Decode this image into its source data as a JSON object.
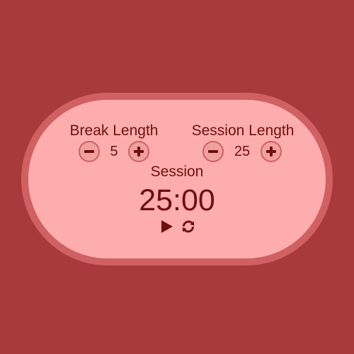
{
  "break": {
    "label": "Break Length",
    "value": "5",
    "decrement_icon": "minus-circle-icon",
    "increment_icon": "plus-circle-icon"
  },
  "session": {
    "label": "Session Length",
    "value": "25",
    "decrement_icon": "minus-circle-icon",
    "increment_icon": "plus-circle-icon"
  },
  "timer": {
    "label": "Session",
    "time": "25:00",
    "play_icon": "play-icon",
    "reset_icon": "refresh-icon"
  },
  "colors": {
    "background": "#a83a3b",
    "panel": "#fdadad",
    "panel_border": "#d06062",
    "text": "#6f0f10"
  }
}
